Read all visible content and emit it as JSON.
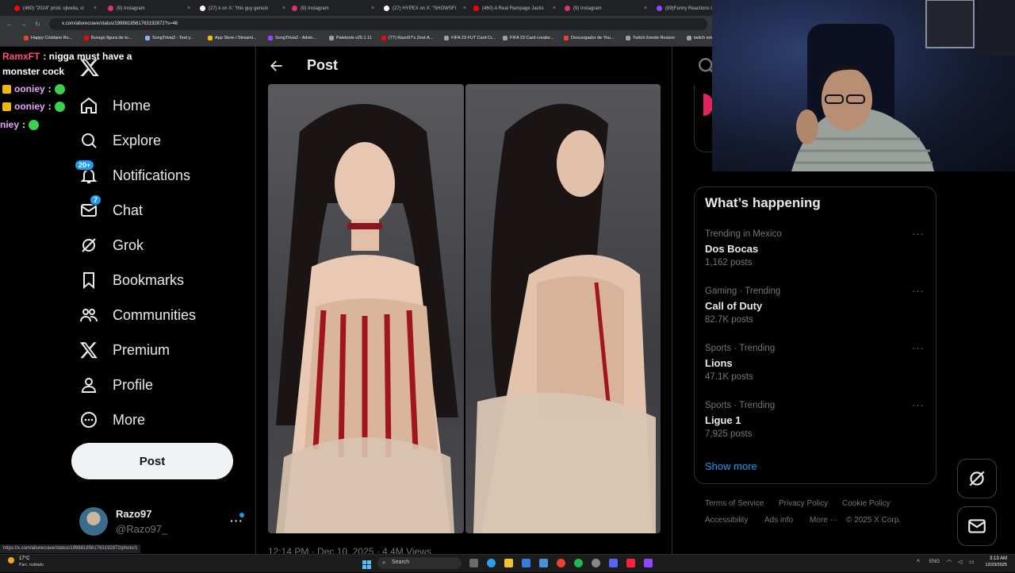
{
  "browser": {
    "tabs": [
      {
        "title": "(460) \"2024\" prod. ojiveita, cr",
        "color": "#ff0000"
      },
      {
        "title": "(9) Instagram",
        "color": "#e1306c"
      },
      {
        "title": "(27) k on X: \"this guy genuin",
        "color": "#ffffff"
      },
      {
        "title": "(9) Instagram",
        "color": "#e1306c"
      },
      {
        "title": "(27) HYPEX on X: \"SHOWSFI",
        "color": "#ffffff"
      },
      {
        "title": "(460) A Real Rampage Jacks",
        "color": "#ff0000"
      },
      {
        "title": "(9) Instagram",
        "color": "#e1306c"
      },
      {
        "title": "(89)Funny Reactions t",
        "color": "#9146ff"
      }
    ],
    "url": "x.com/allurecrave/status/1998818561763192872?s=46",
    "bookmarks": [
      {
        "label": "Happy Cristiano Ro...",
        "color": "#ea4335"
      },
      {
        "label": "Burago figura de to...",
        "color": "#ff0000"
      },
      {
        "label": "SongTrivia2 - Test y...",
        "color": "#8ab4f8"
      },
      {
        "label": "App Store / Streami...",
        "color": "#fbbc04"
      },
      {
        "label": "SongTrivia2 - Advin...",
        "color": "#a142f4"
      },
      {
        "label": "Paletools v25.1.11",
        "color": "#9aa0a6"
      },
      {
        "label": "(77) Razo97's Zest-A...",
        "color": "#ff0000"
      },
      {
        "label": "FIFA 23 FUT Card Cr...",
        "color": "#9aa0a6"
      },
      {
        "label": "FIFA 23 Card creator...",
        "color": "#9aa0a6"
      },
      {
        "label": "Descargador de You...",
        "color": "#ea4335"
      },
      {
        "label": "Twitch Emote Resizer",
        "color": "#9aa0a6"
      },
      {
        "label": "twitch em",
        "color": "#9aa0a6"
      }
    ]
  },
  "chat": [
    {
      "user": "RamxFT",
      "text": ": nigga must have a",
      "user_color": "#ff4f7b"
    },
    {
      "user": "",
      "text": "monster cock",
      "user_color": "#ffffff"
    },
    {
      "user": "ooniey",
      "text": ":",
      "user_color": "#e6a4ff"
    },
    {
      "user": "ooniey",
      "text": ":",
      "user_color": "#e6a4ff"
    },
    {
      "user": "niey",
      "text": ":",
      "user_color": "#e6a4ff"
    }
  ],
  "nav": {
    "items": [
      {
        "label": "Home",
        "icon": "home-icon"
      },
      {
        "label": "Explore",
        "icon": "search-icon"
      },
      {
        "label": "Notifications",
        "icon": "bell-icon",
        "badge": "20+"
      },
      {
        "label": "Chat",
        "icon": "mail-icon",
        "badge": "7"
      },
      {
        "label": "Grok",
        "icon": "grok-icon"
      },
      {
        "label": "Bookmarks",
        "icon": "bookmark-icon"
      },
      {
        "label": "Communities",
        "icon": "communities-icon"
      },
      {
        "label": "Premium",
        "icon": "x-logo-icon"
      },
      {
        "label": "Profile",
        "icon": "person-icon"
      },
      {
        "label": "More",
        "icon": "more-circle-icon"
      }
    ],
    "post_label": "Post",
    "account": {
      "name": "Razo97",
      "handle": "@Razo97_"
    }
  },
  "post": {
    "header": "Post",
    "meta": "12:14 PM · Dec 10, 2025 · 4.4M Views"
  },
  "trends": {
    "title": "What’s happening",
    "items": [
      {
        "context": "Trending in Mexico",
        "name": "Dos Bocas",
        "count": "1,162 posts"
      },
      {
        "context": "Gaming · Trending",
        "name": "Call of Duty",
        "count": "82.7K posts"
      },
      {
        "context": "Sports · Trending",
        "name": "Lions",
        "count": "47.1K posts"
      },
      {
        "context": "Sports · Trending",
        "name": "Ligue 1",
        "count": "7,925 posts"
      }
    ],
    "show_more": "Show more"
  },
  "footer": {
    "links": [
      "Terms of Service",
      "Privacy Policy",
      "Cookie Policy",
      "Accessibility",
      "Ads info",
      "More ···"
    ],
    "copyright": "© 2025 X Corp."
  },
  "status_link": "https://x.com/allurecrave/status/1998818561763192872/photo/1",
  "taskbar": {
    "weather_temp": "17°C",
    "weather_desc": "Parc. nublado",
    "search": "Search",
    "lang": "ENG",
    "time": "3:13 AM",
    "date": "12/23/2025"
  }
}
